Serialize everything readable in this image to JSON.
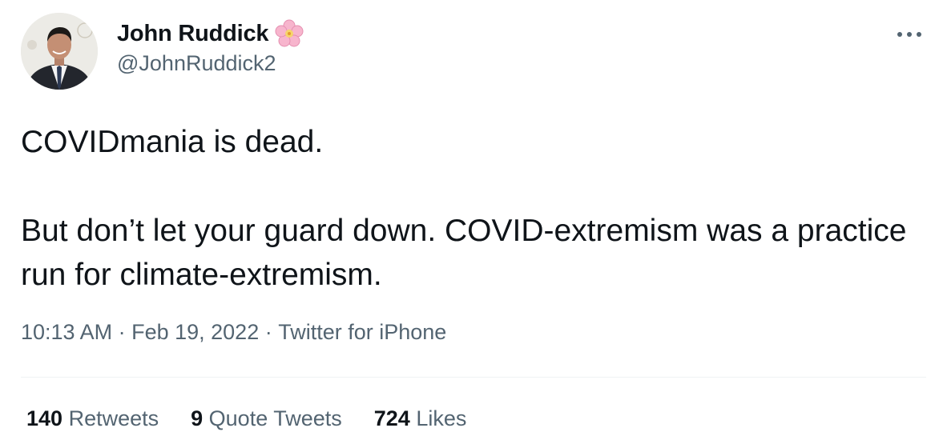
{
  "author": {
    "display_name": "John Ruddick",
    "name_emoji": "cherry-blossom-icon",
    "handle": "@JohnRuddick2",
    "avatar": "profile-photo"
  },
  "tweet": {
    "paragraphs": [
      "COVIDmania is dead.",
      "But don’t let your guard down. COVID-extremism was a practice run for climate-extremism."
    ]
  },
  "meta": {
    "time": "10:13 AM",
    "separator": " · ",
    "date": "Feb 19, 2022",
    "source": "Twitter for iPhone"
  },
  "stats": {
    "retweets": {
      "count": "140",
      "label": " Retweets"
    },
    "quotes": {
      "count": "9",
      "label": " Quote Tweets"
    },
    "likes": {
      "count": "724",
      "label": " Likes"
    }
  },
  "colors": {
    "text_primary": "#0f1419",
    "text_secondary": "#536471",
    "divider": "#eff3f4"
  }
}
